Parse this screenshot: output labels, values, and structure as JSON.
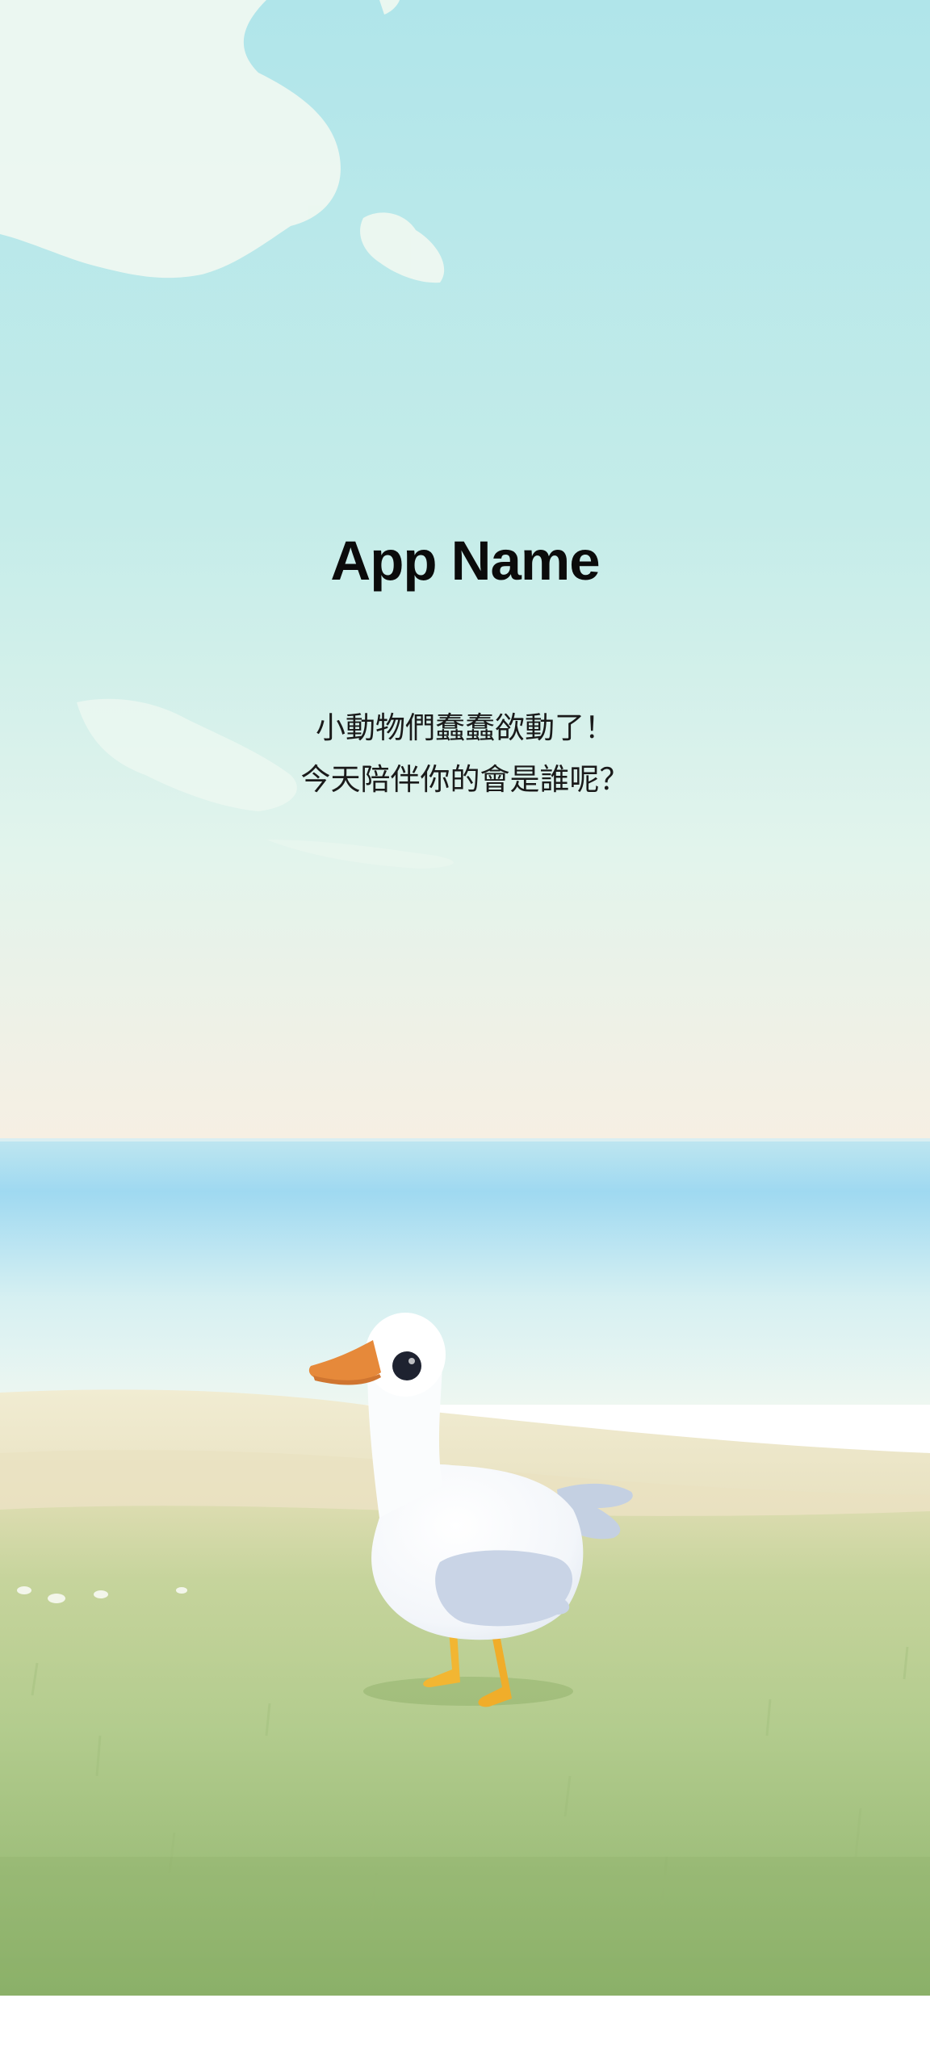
{
  "app": {
    "title": "App Name",
    "subtitle_line1": "小動物們蠢蠢欲動了！",
    "subtitle_line2": "今天陪伴你的會是誰呢？"
  },
  "scene": {
    "character": "goose",
    "background": "sky-sea-grass-landscape"
  },
  "colors": {
    "sky_top": "#b2e6ea",
    "sky_horizon": "#f4efe4",
    "sea": "#a8dcf0",
    "sand": "#ece6c8",
    "grass": "#9cc07c",
    "goose_body": "#ffffff",
    "goose_beak": "#e8913c",
    "goose_feet": "#f2b632",
    "goose_wing": "#c9d4e6",
    "title_text": "#0b0b0b"
  }
}
